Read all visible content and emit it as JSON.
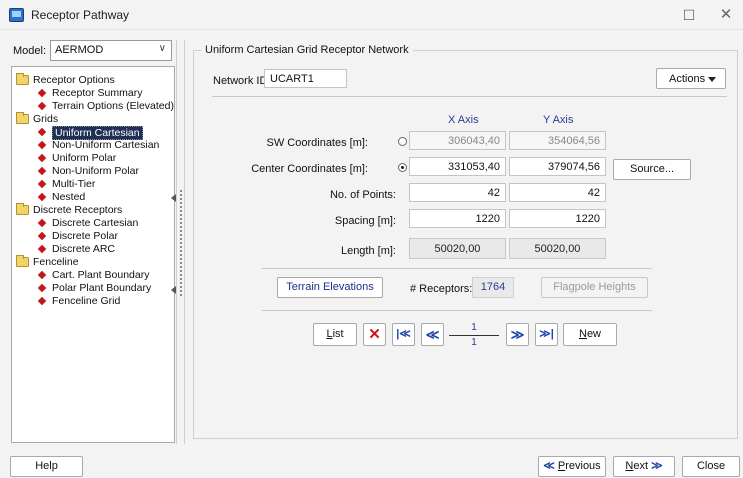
{
  "window": {
    "title": "Receptor Pathway",
    "maximize_glyph": "☐",
    "close_glyph": "✕"
  },
  "left": {
    "model_label": "Model:",
    "model_value": "AERMOD",
    "tree": [
      {
        "type": "folder",
        "label": "Receptor Options"
      },
      {
        "type": "item",
        "label": "Receptor Summary"
      },
      {
        "type": "item",
        "label": "Terrain Options (Elevated)"
      },
      {
        "type": "folder",
        "label": "Grids"
      },
      {
        "type": "item",
        "label": "Uniform Cartesian",
        "selected": true
      },
      {
        "type": "item",
        "label": "Non-Uniform Cartesian"
      },
      {
        "type": "item",
        "label": "Uniform Polar"
      },
      {
        "type": "item",
        "label": "Non-Uniform Polar"
      },
      {
        "type": "item",
        "label": "Multi-Tier"
      },
      {
        "type": "item",
        "label": "Nested"
      },
      {
        "type": "folder",
        "label": "Discrete Receptors"
      },
      {
        "type": "item",
        "label": "Discrete Cartesian"
      },
      {
        "type": "item",
        "label": "Discrete Polar"
      },
      {
        "type": "item",
        "label": "Discrete ARC"
      },
      {
        "type": "folder",
        "label": "Fenceline"
      },
      {
        "type": "item",
        "label": "Cart. Plant Boundary"
      },
      {
        "type": "item",
        "label": "Polar Plant Boundary"
      },
      {
        "type": "item",
        "label": "Fenceline Grid"
      }
    ]
  },
  "main": {
    "group_title": "Uniform Cartesian Grid Receptor Network",
    "network_label": "Network ID:",
    "network_value": "UCART1",
    "actions_label": "Actions",
    "x_axis": "X Axis",
    "y_axis": "Y Axis",
    "sw_label": "SW Coordinates [m]:",
    "sw_x": "306043,40",
    "sw_y": "354064,56",
    "center_label": "Center Coordinates [m]:",
    "center_x": "331053,40",
    "center_y": "379074,56",
    "source_label": "Source...",
    "points_label": "No. of Points:",
    "points_x": "42",
    "points_y": "42",
    "spacing_label": "Spacing [m]:",
    "spacing_x": "1220",
    "spacing_y": "1220",
    "length_label": "Length [m]:",
    "length_x": "50020,00",
    "length_y": "50020,00",
    "terrain_label": "Terrain Elevations",
    "receptors_label": "# Receptors:",
    "receptors_value": "1764",
    "flagpole_label": "Flagpole Heights",
    "list_first": "L",
    "list_rest": "ist",
    "delete_glyph": "✕",
    "first_glyph": "|≪",
    "prev_glyph": "≪",
    "page_current": "1",
    "page_total": "1",
    "next_glyph": "≫",
    "last_glyph": "≫|",
    "new_first": "N",
    "new_rest": "ew"
  },
  "footer": {
    "help": "Help",
    "previous_first": "P",
    "previous_rest": "revious",
    "previous_glyph": "≪",
    "next_first": "N",
    "next_rest": "ext",
    "next_glyph": "≫",
    "close": "Close"
  }
}
